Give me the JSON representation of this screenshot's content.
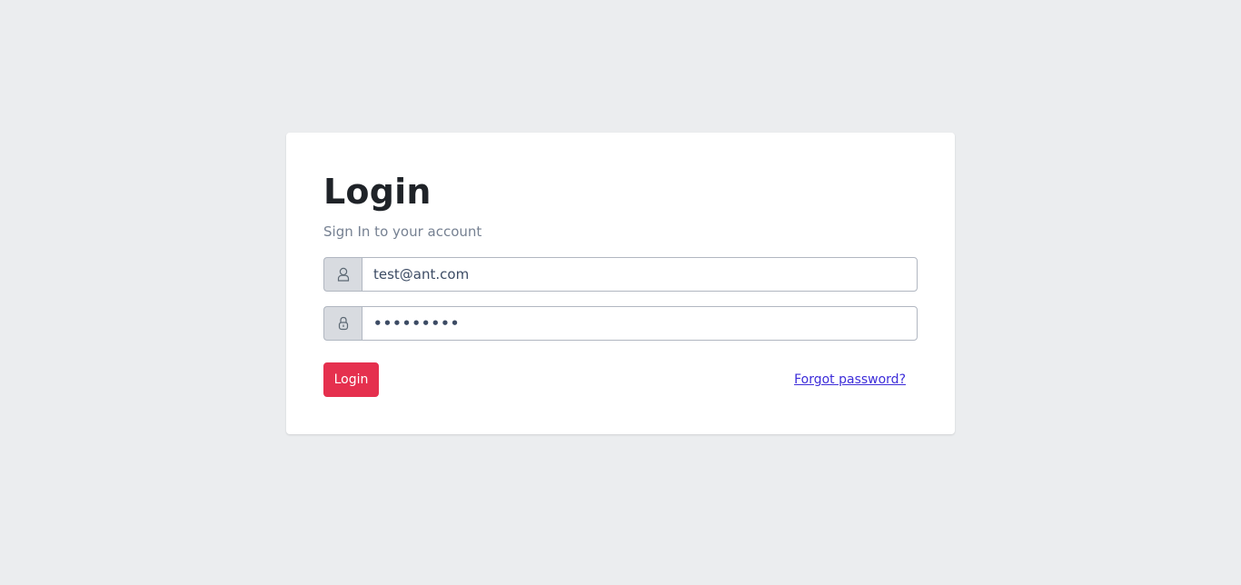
{
  "login": {
    "title": "Login",
    "subtitle": "Sign In to your account",
    "email": {
      "value": "test@ant.com",
      "icon": "user-icon"
    },
    "password": {
      "value": "•••••••••",
      "icon": "lock-icon"
    },
    "login_button_label": "Login",
    "forgot_password_label": "Forgot password?"
  },
  "colors": {
    "background": "#ebedef",
    "card": "#ffffff",
    "primary_button": "#e5304e",
    "link": "#3d2dd9",
    "addon_background": "#d8dbe0",
    "border": "#b1b7c1"
  }
}
